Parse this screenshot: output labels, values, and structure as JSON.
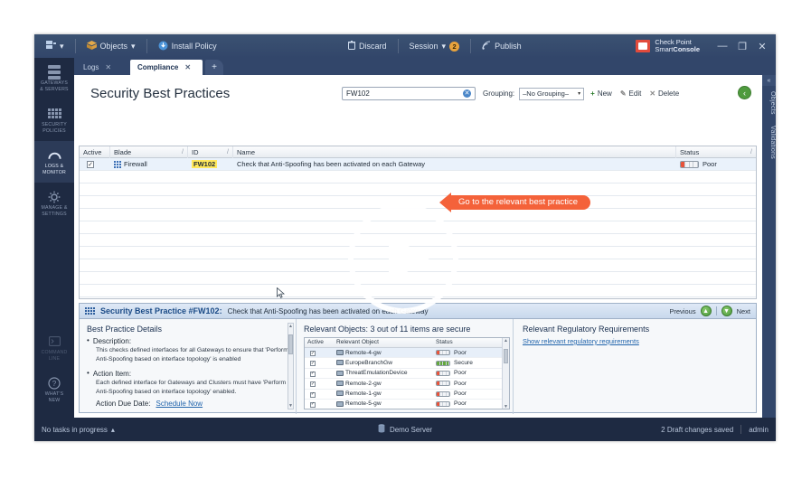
{
  "window": {
    "brand_line1": "Check Point",
    "brand_line2_normal": "Smart",
    "brand_line2_bold": "Console",
    "minimize": "—",
    "restore": "❐",
    "close": "✕"
  },
  "toolbar": {
    "menu_label": "▾",
    "objects_label": "Objects",
    "objects_caret": "▾",
    "install_policy_label": "Install Policy",
    "discard_label": "Discard",
    "session_label": "Session",
    "session_caret": "▾",
    "session_badge": "2",
    "publish_label": "Publish"
  },
  "tabs": {
    "items": [
      {
        "label": "Logs",
        "close": "✕",
        "active": false
      },
      {
        "label": "Compliance",
        "close": "✕",
        "active": true
      }
    ],
    "add_label": "+"
  },
  "sidebar": {
    "items": [
      {
        "label_line1": "GATEWAYS",
        "label_line2": "& SERVERS",
        "icon": "servers-icon",
        "active": false
      },
      {
        "label_line1": "SECURITY",
        "label_line2": "POLICIES",
        "icon": "grid-icon",
        "active": false
      },
      {
        "label_line1": "LOGS &",
        "label_line2": "MONITOR",
        "icon": "gauge-icon",
        "active": true
      },
      {
        "label_line1": "MANAGE &",
        "label_line2": "SETTINGS",
        "icon": "gear-icon",
        "active": false
      }
    ],
    "bottom_items": [
      {
        "label_line1": "COMMAND",
        "label_line2": "LINE",
        "icon": "terminal-icon"
      },
      {
        "label_line1": "WHAT'S",
        "label_line2": "NEW",
        "icon": "question-icon"
      }
    ]
  },
  "right_dock": {
    "collapse": "«",
    "tabs": [
      "Objects",
      "Validations"
    ]
  },
  "page": {
    "title": "Security Best Practices",
    "search_value": "FW102",
    "search_clear": "✕",
    "grouping_label": "Grouping:",
    "grouping_value": "–No Grouping–",
    "grouping_caret": "▾",
    "new_label": "New",
    "new_icon": "+",
    "edit_label": "Edit",
    "edit_icon": "✎",
    "delete_label": "Delete",
    "delete_icon": "✕",
    "collapse_icon": "‹"
  },
  "grid": {
    "columns": [
      {
        "label": "Active",
        "sort": ""
      },
      {
        "label": "Blade",
        "sort": "/"
      },
      {
        "label": "ID",
        "sort": "/"
      },
      {
        "label": "Name",
        "sort": ""
      },
      {
        "label": "Status",
        "sort": "/"
      }
    ],
    "rows": [
      {
        "active": "✓",
        "blade": "Firewall",
        "id": "FW102",
        "name": "Check that Anti-Spoofing has been activated on each Gateway",
        "status": "Poor",
        "status_level": "poor"
      }
    ],
    "empty_row_count": 11
  },
  "callout": {
    "text": "Go to the relevant best practice"
  },
  "details": {
    "icon": "grid-icon",
    "title": "Security Best Practice #FW102:",
    "subtitle": "Check that Anti-Spoofing has been activated on each Gateway",
    "previous_label": "Previous",
    "previous_icon": "▲",
    "next_label": "Next",
    "next_icon": "▼",
    "left": {
      "heading": "Best Practice Details",
      "description_label": "Description:",
      "description_text": "This checks defined interfaces for all Gateways to ensure that 'Perform Anti-Spoofing based on interface topology' is enabled",
      "action_label": "Action Item:",
      "action_text": "Each defined interface for Gateways and Clusters must have 'Perform Anti-Spoofing based on interface topology' enabled.",
      "due_label": "Action Due Date:",
      "due_link": "Schedule Now",
      "scroll_up": "▲",
      "scroll_down": "▼"
    },
    "middle": {
      "heading": "Relevant Objects: 3 out of 11 items are secure",
      "columns": [
        "Active",
        "Relevant Object",
        "Status"
      ],
      "rows": [
        {
          "active": "✓",
          "object": "Remote-4-gw",
          "status": "Poor",
          "status_level": "poor",
          "selected": true
        },
        {
          "active": "✓",
          "object": "EuropeBranchGw",
          "status": "Secure",
          "status_level": "secure",
          "selected": false
        },
        {
          "active": "✓",
          "object": "ThreatEmulationDevice",
          "status": "Poor",
          "status_level": "poor",
          "selected": false
        },
        {
          "active": "✓",
          "object": "Remote-2-gw",
          "status": "Poor",
          "status_level": "poor",
          "selected": false
        },
        {
          "active": "✓",
          "object": "Remote-1-gw",
          "status": "Poor",
          "status_level": "poor",
          "selected": false
        },
        {
          "active": "✓",
          "object": "Remote-5-gw",
          "status": "Poor",
          "status_level": "poor",
          "selected": false
        }
      ],
      "scroll_up": "▲",
      "scroll_down": "▼"
    },
    "right": {
      "heading": "Relevant Regulatory Requirements",
      "link": "Show relevant regulatory requirements"
    }
  },
  "statusbar": {
    "tasks": "No tasks in progress",
    "tasks_caret": "▴",
    "server": "Demo Server",
    "changes": "2 Draft changes saved",
    "user": "admin"
  },
  "overlay": {
    "play": "play-button"
  },
  "colors": {
    "accent_orange": "#f4623a",
    "brand_navy": "#1e2a42",
    "toolbar_blue": "#32466a",
    "status_poor": "#e8533a",
    "status_secure": "#63a83c",
    "highlight_yellow": "#ffe85c"
  }
}
